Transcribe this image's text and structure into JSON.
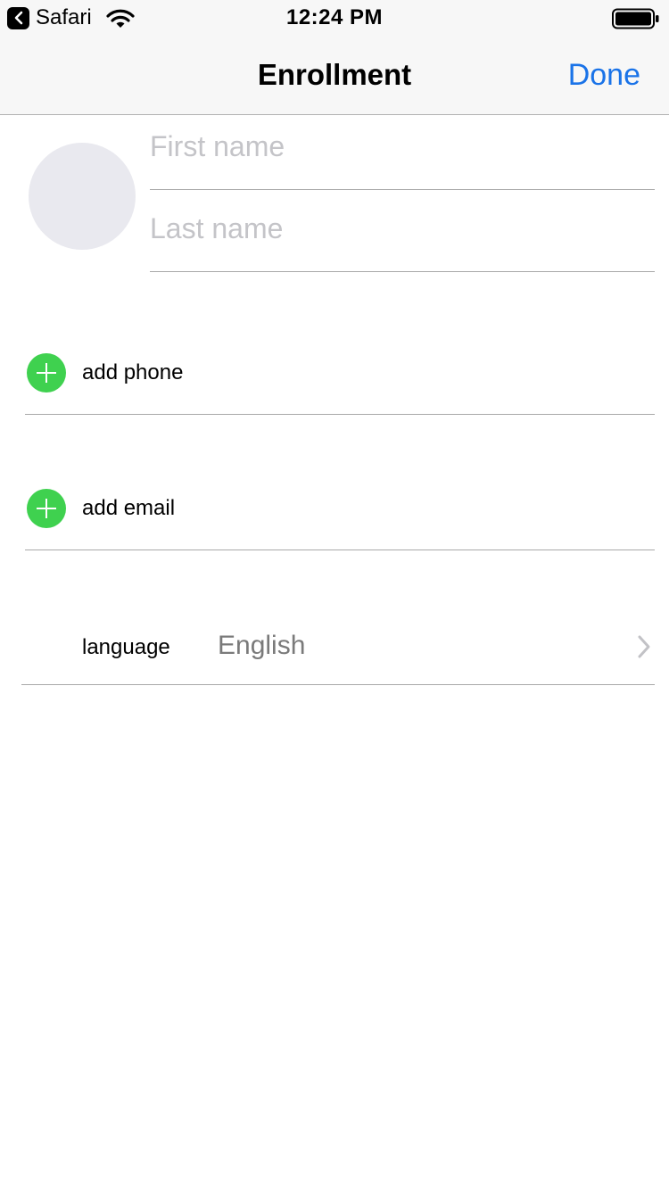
{
  "status_bar": {
    "back_app_label": "Safari",
    "time": "12:24 PM"
  },
  "nav": {
    "title": "Enrollment",
    "done_label": "Done"
  },
  "name": {
    "first_placeholder": "First name",
    "last_placeholder": "Last name"
  },
  "phone": {
    "label": "add phone"
  },
  "email": {
    "label": "add email"
  },
  "language": {
    "label": "language",
    "value": "English"
  },
  "colors": {
    "accent": "#1a73e8",
    "add_green": "#3fd14f",
    "avatar_bg": "#e9e9ef",
    "header_bg": "#f7f7f7"
  },
  "icons": {
    "back": "chevron-left-icon",
    "wifi": "wifi-icon",
    "battery": "battery-icon",
    "add": "plus-circle-icon",
    "disclosure": "chevron-right-icon"
  }
}
